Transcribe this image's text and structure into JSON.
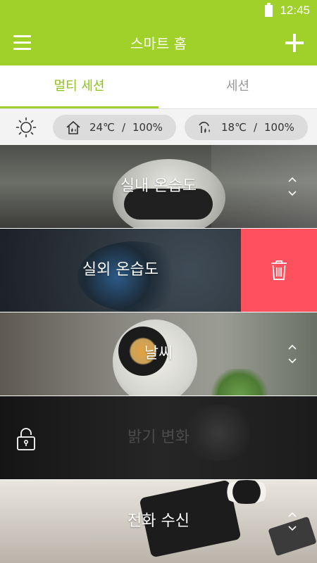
{
  "status_bar": {
    "time": "12:45",
    "battery_icon": "battery-icon"
  },
  "app_bar": {
    "title": "스마트 홈",
    "menu_icon": "hamburger-menu-icon",
    "add_icon": "plus-icon"
  },
  "tabs": [
    {
      "label": "멀티 세션",
      "active": true
    },
    {
      "label": "세션",
      "active": false
    }
  ],
  "environment": {
    "weather_icon": "sun-icon",
    "indoor": {
      "icon": "house-humidity-icon",
      "temperature": "24℃",
      "separator": "/",
      "humidity": "100%"
    },
    "outdoor": {
      "icon": "outdoor-humidity-icon",
      "temperature": "18℃",
      "separator": "/",
      "humidity": "100%"
    }
  },
  "scenes": [
    {
      "label": "실내 온습도",
      "control": "reorder-chevrons-icon"
    },
    {
      "label": "실외 온습도",
      "control": "delete-button",
      "delete_icon": "trash-icon"
    },
    {
      "label": "날씨",
      "control": "reorder-chevrons-icon"
    },
    {
      "label": "밝기 변화",
      "control": "lock-icon",
      "locked": true
    },
    {
      "label": "전화 수신",
      "control": "reorder-chevrons-icon"
    }
  ],
  "colors": {
    "accent": "#9fd12a",
    "delete": "#fe515e",
    "pill_bg": "#dcdcdc"
  }
}
